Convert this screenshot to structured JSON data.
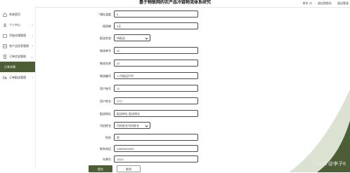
{
  "app": {
    "title": "基于物联网的农产品冷链物流体系研究",
    "user": "尚辛 22",
    "link_home": "退出到前台",
    "link_logout": "退出登录"
  },
  "sidebar": {
    "items": [
      {
        "label": "系统首页",
        "icon": "home-icon",
        "active": false
      },
      {
        "label": "个人中心",
        "icon": "user-icon",
        "active": false
      },
      {
        "label": "冷链仓储管理",
        "icon": "warehouse-icon",
        "active": false
      },
      {
        "label": "农产品信息管理",
        "icon": "produce-icon",
        "active": false
      },
      {
        "label": "订单信息管理",
        "icon": "order-icon",
        "active": false
      },
      {
        "label": "订单详情",
        "icon": "",
        "active": true
      },
      {
        "label": "订单配送管理",
        "icon": "delivery-icon",
        "active": false
      }
    ]
  },
  "form": {
    "fields": [
      {
        "label": "储存温度",
        "required": true,
        "value": "0",
        "type": "input"
      },
      {
        "label": "保质期",
        "required": false,
        "value": "3天",
        "type": "input"
      },
      {
        "label": "配送状态",
        "required": false,
        "value": "待配送",
        "type": "select"
      },
      {
        "label": "物流单号",
        "required": false,
        "value": "22",
        "type": "input"
      },
      {
        "label": "物流名称",
        "required": false,
        "value": "22",
        "type": "input"
      },
      {
        "label": "物流编号",
        "required": false,
        "value": "入冷链运行中",
        "type": "input"
      },
      {
        "label": "用户账号",
        "required": false,
        "value": "11",
        "type": "input"
      },
      {
        "label": "用户姓名",
        "required": false,
        "value": "小小",
        "type": "input"
      },
      {
        "label": "配送地址",
        "required": false,
        "value": "配送地址 配送地址",
        "type": "input"
      },
      {
        "label": "司机姓名",
        "required": false,
        "value": "司机姓名司机姓名",
        "type": "input"
      },
      {
        "label": "性别",
        "required": false,
        "value": "男",
        "type": "input"
      },
      {
        "label": "联系电话",
        "required": false,
        "value": "13823000000",
        "type": "input"
      },
      {
        "label": "车牌号",
        "required": false,
        "value": "11111",
        "type": "input"
      }
    ],
    "submit_label": "提交",
    "cancel_label": "取消"
  },
  "watermark": "CSDN @李子6",
  "colors": {
    "accent": "#4d5e36",
    "deco": "#dbe2d2"
  }
}
